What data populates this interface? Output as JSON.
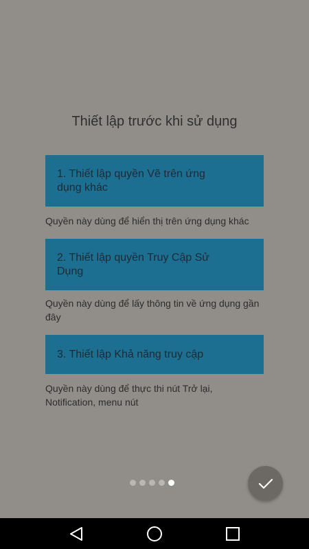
{
  "setup": {
    "title": "Thiết lập trước khi sử dụng",
    "steps": [
      {
        "label": "1. Thiết lập quyền Vẽ trên ứng dụng khác",
        "description": "Quyền này dùng để hiển thị trên ứng dụng khác"
      },
      {
        "label": "2. Thiết lập quyền Truy Cập Sử Dụng",
        "description": "Quyền này dùng để lấy thông tin về ứng dụng gần đây"
      },
      {
        "label": "3. Thiết lập Khả năng truy cập",
        "description": "Quyền này dùng để thực thi nút Trở lại, Notification, menu nút"
      }
    ]
  },
  "pager": {
    "total_pages": 5,
    "current_page": 5
  },
  "colors": {
    "background": "#918d88",
    "button": "#1d6f92",
    "fab": "#6c6965",
    "navbar": "#000000"
  },
  "icons": {
    "fab": "checkmark-icon",
    "nav_back": "back-triangle-icon",
    "nav_home": "home-circle-icon",
    "nav_recents": "recents-square-icon"
  }
}
